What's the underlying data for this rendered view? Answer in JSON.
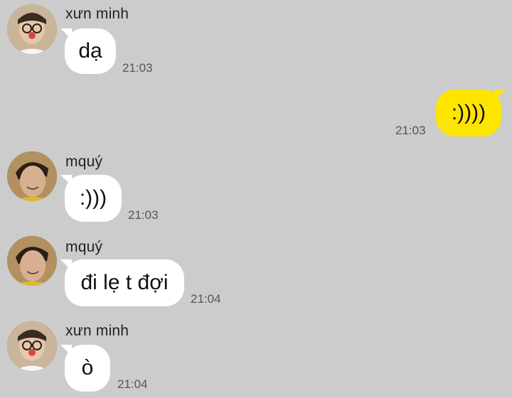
{
  "messages": [
    {
      "sender": "xưn minh",
      "text": "dạ",
      "time": "21:03",
      "direction": "incoming",
      "avatar": "avatar-minh"
    },
    {
      "sender": "",
      "text": ":))))",
      "time": "21:03",
      "direction": "outgoing"
    },
    {
      "sender": "mquý",
      "text": ":)))",
      "time": "21:03",
      "direction": "incoming",
      "avatar": "avatar-quy"
    },
    {
      "sender": "mquý",
      "text": "đi lẹ t đợi",
      "time": "21:04",
      "direction": "incoming",
      "avatar": "avatar-quy"
    },
    {
      "sender": "xưn minh",
      "text": "ò",
      "time": "21:04",
      "direction": "incoming",
      "avatar": "avatar-minh"
    }
  ],
  "colors": {
    "background": "#cccccc",
    "incoming_bubble": "#ffffff",
    "outgoing_bubble": "#fee500",
    "time_text": "#555555"
  }
}
